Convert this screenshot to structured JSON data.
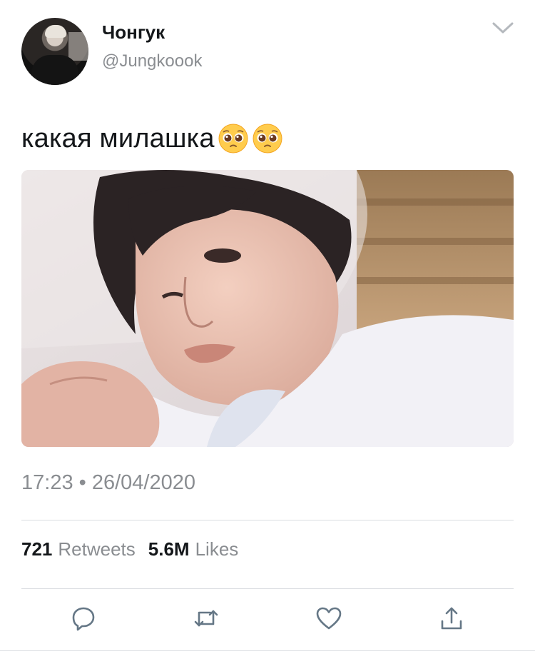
{
  "user": {
    "display_name": "Чонгук",
    "handle": "@Jungkoook"
  },
  "tweet": {
    "text": "какая милашка",
    "emojis": [
      "pleading-face-emoji",
      "pleading-face-emoji"
    ],
    "timestamp": "17:23 • 26/04/2020"
  },
  "stats": {
    "retweets_count": "721",
    "retweets_label": "Retweets",
    "likes_count": "5.6M",
    "likes_label": "Likes"
  },
  "icons": {
    "menu": "chevron-down-icon",
    "reply": "reply-icon",
    "retweet": "retweet-icon",
    "like": "heart-icon",
    "share": "share-icon"
  },
  "colors": {
    "text_primary": "#14171a",
    "text_secondary": "#8a8d91",
    "divider": "#dadde1",
    "icon": "#657786"
  }
}
